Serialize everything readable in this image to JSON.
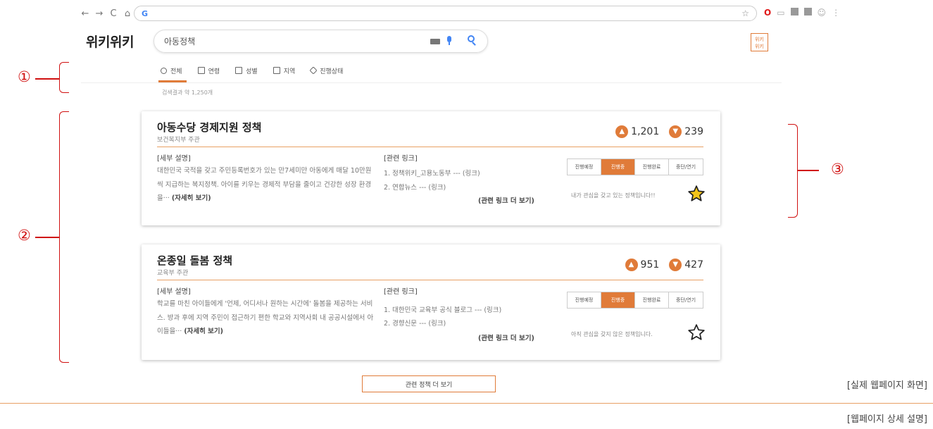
{
  "browser": {
    "nav_icons": [
      "←",
      "→",
      "C",
      "⌂"
    ],
    "address_text": "G",
    "extensions": [
      "☆",
      "O",
      "▭",
      "▪",
      "▪",
      "☺",
      "⋮"
    ]
  },
  "header": {
    "logo": "위키위키",
    "search_value": "아동정책",
    "brand_badge": "위키\n위키"
  },
  "tabs": [
    {
      "label": "전체"
    },
    {
      "label": "연령"
    },
    {
      "label": "성별"
    },
    {
      "label": "지역"
    },
    {
      "label": "진행상태"
    }
  ],
  "result_count": "검색결과 약 1,250개",
  "annotations": {
    "one": "①",
    "two": "②",
    "three": "③"
  },
  "cards": [
    {
      "title": "아동수당 경제지원 정책",
      "ministry": "보건복지부 주관",
      "likes": "1,201",
      "dislikes": "239",
      "detail_heading": "[세부 설명]",
      "detail_text": "대한민국 국적을 갖고 주민등록번호가 있는 만7세미만 아동에게 매달 10만원 씩 지급하는 복지정책. 아이를 키우는 경제적 부담을 줄이고 건강한 성장 환경을···",
      "detail_more": "(자세히 보기)",
      "links_heading": "[관련 링크]",
      "links": [
        "1. 정책위키_고용노동부 --- (링크)",
        "2. 연합뉴스 --- (링크)"
      ],
      "links_more": "(관련 링크 더 보기)",
      "statuses": [
        "진행예정",
        "진행중",
        "진행완료",
        "중단/연기"
      ],
      "active_status": "진행중",
      "interest_text": "내가 관심을 갖고 있는 정책입니다!!",
      "starred": true
    },
    {
      "title": "온종일 돌봄 정책",
      "ministry": "교육부 주관",
      "likes": "951",
      "dislikes": "427",
      "detail_heading": "[세부 설명]",
      "detail_text": "학교를 마친 아이들에게 '언제, 어디서나 원하는 시간에' 돌봄을 제공하는 서비스. 방과 후에 지역 주민이 접근하기 편한 학교와 지역사회 내 공공시설에서 아이들을···",
      "detail_more": "(자세히 보기)",
      "links_heading": "[관련 링크]",
      "links": [
        "1. 대한민국 교육부 공식 블로그 --- (링크)",
        "2. 경향신문 --- (링크)"
      ],
      "links_more": "(관련 링크 더 보기)",
      "statuses": [
        "진행예정",
        "진행중",
        "진행완료",
        "중단/연기"
      ],
      "active_status": "진행중",
      "interest_text": "아직 관심을 갖지 않은 정책입니다.",
      "starred": false
    }
  ],
  "more_button": "관련 정책 더 보기",
  "labels": {
    "actual": "[실제 웹페이지 화면]",
    "detail": "[웹페이지 상세 설명]"
  },
  "colors": {
    "accent": "#e07b39",
    "annotation": "#d01010",
    "star_fill": "#f5c518"
  }
}
